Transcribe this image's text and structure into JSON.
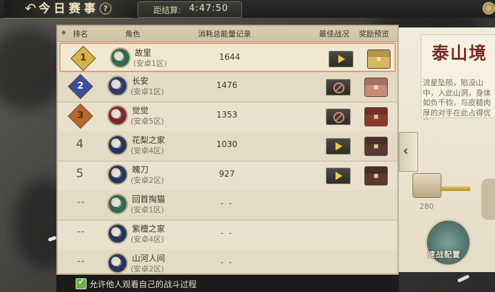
{
  "header": {
    "title": "今日赛事",
    "help_icon": "?",
    "timer_label": "距结算:",
    "timer_value": "4:47:50"
  },
  "table": {
    "columns": [
      "排名",
      "角色",
      "消耗总能量记录",
      "最佳战况",
      "奖励预览"
    ],
    "rows": [
      {
        "rank": "1",
        "name": "故里",
        "server": "(安卓1区)",
        "score": "1644",
        "battle": "play",
        "avatar_color": "#2f6b4e",
        "chest_color": "#d9b660",
        "selected": true
      },
      {
        "rank": "2",
        "name": "长安",
        "server": "(安卓1区)",
        "score": "1476",
        "battle": "blocked",
        "avatar_color": "#2a3a6a",
        "chest_color": "#c98a7a",
        "selected": false
      },
      {
        "rank": "3",
        "name": "觉觉",
        "server": "(安卓5区)",
        "score": "1353",
        "battle": "blocked",
        "avatar_color": "#7a2a2a",
        "chest_color": "#8a3a30",
        "selected": false
      },
      {
        "rank": "4",
        "name": "花梨之家",
        "server": "(安卓4区)",
        "score": "1030",
        "battle": "play",
        "avatar_color": "#26355e",
        "chest_color": "#5a3a32",
        "selected": false
      },
      {
        "rank": "5",
        "name": "魄刀",
        "server": "(安卓2区)",
        "score": "927",
        "battle": "play",
        "avatar_color": "#26355e",
        "chest_color": "#5a3a32",
        "selected": false
      },
      {
        "rank": "--",
        "name": "回首掏猫",
        "server": "(安卓1区)",
        "score": "- -",
        "battle": "",
        "avatar_color": "#2f6b4e",
        "chest_color": "",
        "selected": false
      },
      {
        "rank": "--",
        "name": "紫檀之家",
        "server": "(安卓4区)",
        "score": "- -",
        "battle": "",
        "avatar_color": "#26355e",
        "chest_color": "",
        "selected": false
      },
      {
        "rank": "--",
        "name": "山河人间",
        "server": "(安卓2区)",
        "score": "- -",
        "battle": "",
        "avatar_color": "#26355e",
        "chest_color": "",
        "selected": false
      }
    ]
  },
  "rank_badge_colors": {
    "1": "#d9b24a",
    "2": "#3a4fa0",
    "3": "#b7682f"
  },
  "side_panel": {
    "title": "泰山境",
    "description": "流星坠陨，陷没山中，入此山洞，身体如负千钧，与皮糙肉厚的对手在此占得优势？",
    "reward_value": "280",
    "gear_label": "速战配置"
  },
  "footer": {
    "allow_watch_label": "允许他人观看自己的战斗过程",
    "allow_watch_checked": true
  }
}
